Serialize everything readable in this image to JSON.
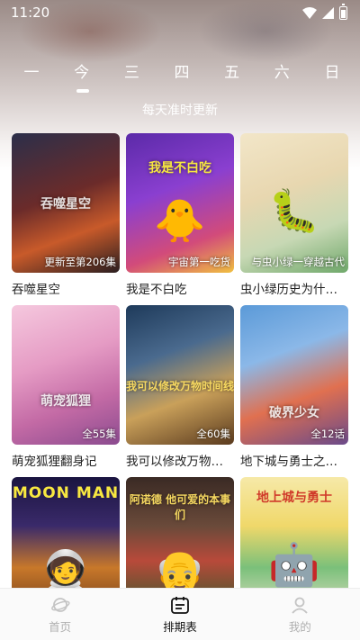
{
  "status": {
    "time": "11:20"
  },
  "weekdays": [
    {
      "label": "一",
      "active": false
    },
    {
      "label": "今",
      "active": true
    },
    {
      "label": "三",
      "active": false
    },
    {
      "label": "四",
      "active": false
    },
    {
      "label": "五",
      "active": false
    },
    {
      "label": "六",
      "active": false
    },
    {
      "label": "日",
      "active": false
    }
  ],
  "update_note": "每天准时更新",
  "cards": [
    {
      "title": "吞噬星空",
      "badge": "更新至第206集",
      "art": "吞噬星空"
    },
    {
      "title": "我是不白吃",
      "badge": "宇宙第一吃货",
      "art": "我是不白吃"
    },
    {
      "title": "虫小绿历史为什…",
      "badge": "与虫小绿一穿越古代",
      "art": ""
    },
    {
      "title": "萌宠狐狸翻身记",
      "badge": "全55集",
      "art": "萌宠狐狸"
    },
    {
      "title": "我可以修改万物…",
      "badge": "全60集",
      "art": "我可以修改万物时间线"
    },
    {
      "title": "地下城与勇士之…",
      "badge": "全12话",
      "art": "破界少女"
    },
    {
      "title": "",
      "badge": "",
      "art": "MOON MAN"
    },
    {
      "title": "",
      "badge": "",
      "art": "阿诺德 他可爱的本事们"
    },
    {
      "title": "",
      "badge": "",
      "art": "地上城与勇士"
    }
  ],
  "nav": {
    "home": "首页",
    "schedule": "排期表",
    "mine": "我的"
  },
  "colors": {
    "accent": "#111111",
    "inactive": "#b0b0b0"
  }
}
